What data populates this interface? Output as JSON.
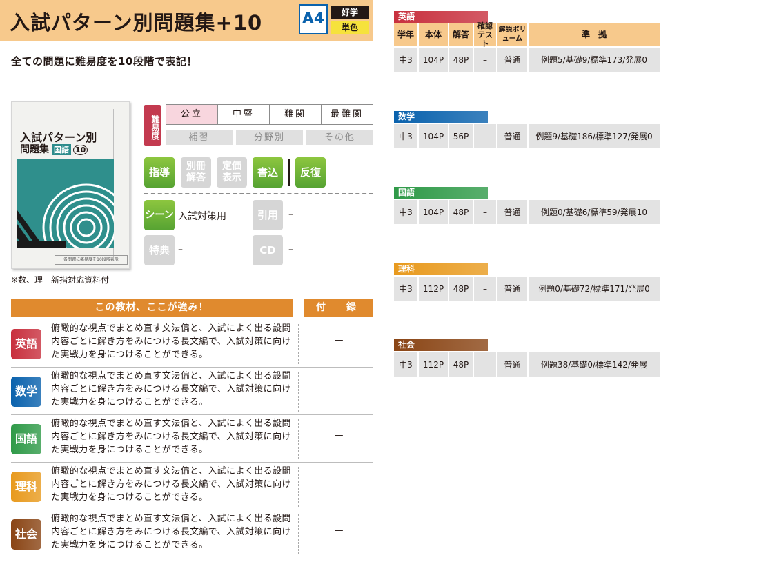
{
  "header": {
    "title": "入試パターン別問題集+10",
    "format": "A4",
    "tag_top": "好学",
    "tag_bottom": "単色"
  },
  "lead": "全ての問題に難易度を10段階で表記！",
  "cover": {
    "title_line1": "入試パターン別",
    "title_line2": "問題集",
    "subject": "国語",
    "number": "10",
    "foot_text": "各問題に難易度を10段階表示",
    "note": "※数、理　新指対応資料付"
  },
  "difficulty": {
    "label": "難易度",
    "levels": [
      {
        "label": "公立",
        "active": true
      },
      {
        "label": "中堅",
        "active": false
      },
      {
        "label": "難関",
        "active": false
      },
      {
        "label": "最難関",
        "active": false
      }
    ],
    "sub": [
      "補習",
      "分野別",
      "その他"
    ]
  },
  "badges": [
    {
      "label": "指導",
      "active": true
    },
    {
      "label": "別冊解答",
      "active": false
    },
    {
      "label": "定価表示",
      "active": false
    },
    {
      "label": "書込",
      "active": true
    },
    {
      "label": "反復",
      "active": true
    }
  ],
  "info": {
    "scene_label": "シーン",
    "scene_value": "入試対策用",
    "quote_label": "引用",
    "quote_value": "–",
    "bonus_label": "特典",
    "bonus_value": "–",
    "cd_label": "CD",
    "cd_value": "–"
  },
  "strengths": {
    "header": "この教材、ここが強み！",
    "furoku_header": "付　録",
    "rows": [
      {
        "subject": "英語",
        "color": "#c8303e",
        "text": "俯瞰的な視点でまとめ直す文法偏と、入試によく出る設問内容ごとに解き方をみにつける長文編で、入試対策に向けた実戦力を身につけることができる。",
        "furoku": "—"
      },
      {
        "subject": "数学",
        "color": "#0a62ad",
        "text": "俯瞰的な視点でまとめ直す文法偏と、入試によく出る設問内容ごとに解き方をみにつける長文編で、入試対策に向けた実戦力を身につけることができる。",
        "furoku": "—"
      },
      {
        "subject": "国語",
        "color": "#2f9a48",
        "text": "俯瞰的な視点でまとめ直す文法偏と、入試によく出る設問内容ごとに解き方をみにつける長文編で、入試対策に向けた実戦力を身につけることができる。",
        "furoku": "—"
      },
      {
        "subject": "理科",
        "color": "#e89a1e",
        "text": "俯瞰的な視点でまとめ直す文法偏と、入試によく出る設問内容ごとに解き方をみにつける長文編で、入試対策に向けた実戦力を身につけることができる。",
        "furoku": "—"
      },
      {
        "subject": "社会",
        "color": "#8a4515",
        "text": "俯瞰的な視点でまとめ直す文法偏と、入試によく出る設問内容ごとに解き方をみにつける長文編で、入試対策に向けた実戦力を身につけることができる。",
        "furoku": "—"
      }
    ]
  },
  "spec": {
    "headers": [
      "学年",
      "本体",
      "解答",
      "確認テスト",
      "解説ボリューム",
      "準　拠"
    ],
    "tables": [
      {
        "subject": "英語",
        "color": "#c8303e",
        "row": [
          "中3",
          "104P",
          "48P",
          "–",
          "普通",
          "例題5/基礎9/標準173/発展0"
        ]
      },
      {
        "subject": "数学",
        "color": "#0a62ad",
        "row": [
          "中3",
          "104P",
          "56P",
          "–",
          "普通",
          "例題9/基礎186/標準127/発展0"
        ]
      },
      {
        "subject": "国語",
        "color": "#2f9a48",
        "row": [
          "中3",
          "104P",
          "48P",
          "–",
          "普通",
          "例題0/基礎6/標準59/発展10"
        ]
      },
      {
        "subject": "理科",
        "color": "#e89a1e",
        "row": [
          "中3",
          "112P",
          "48P",
          "–",
          "普通",
          "例題0/基礎72/標準171/発展0"
        ]
      },
      {
        "subject": "社会",
        "color": "#8a4515",
        "row": [
          "中3",
          "112P",
          "48P",
          "–",
          "普通",
          "例題38/基礎0/標準142/発展"
        ]
      }
    ]
  }
}
